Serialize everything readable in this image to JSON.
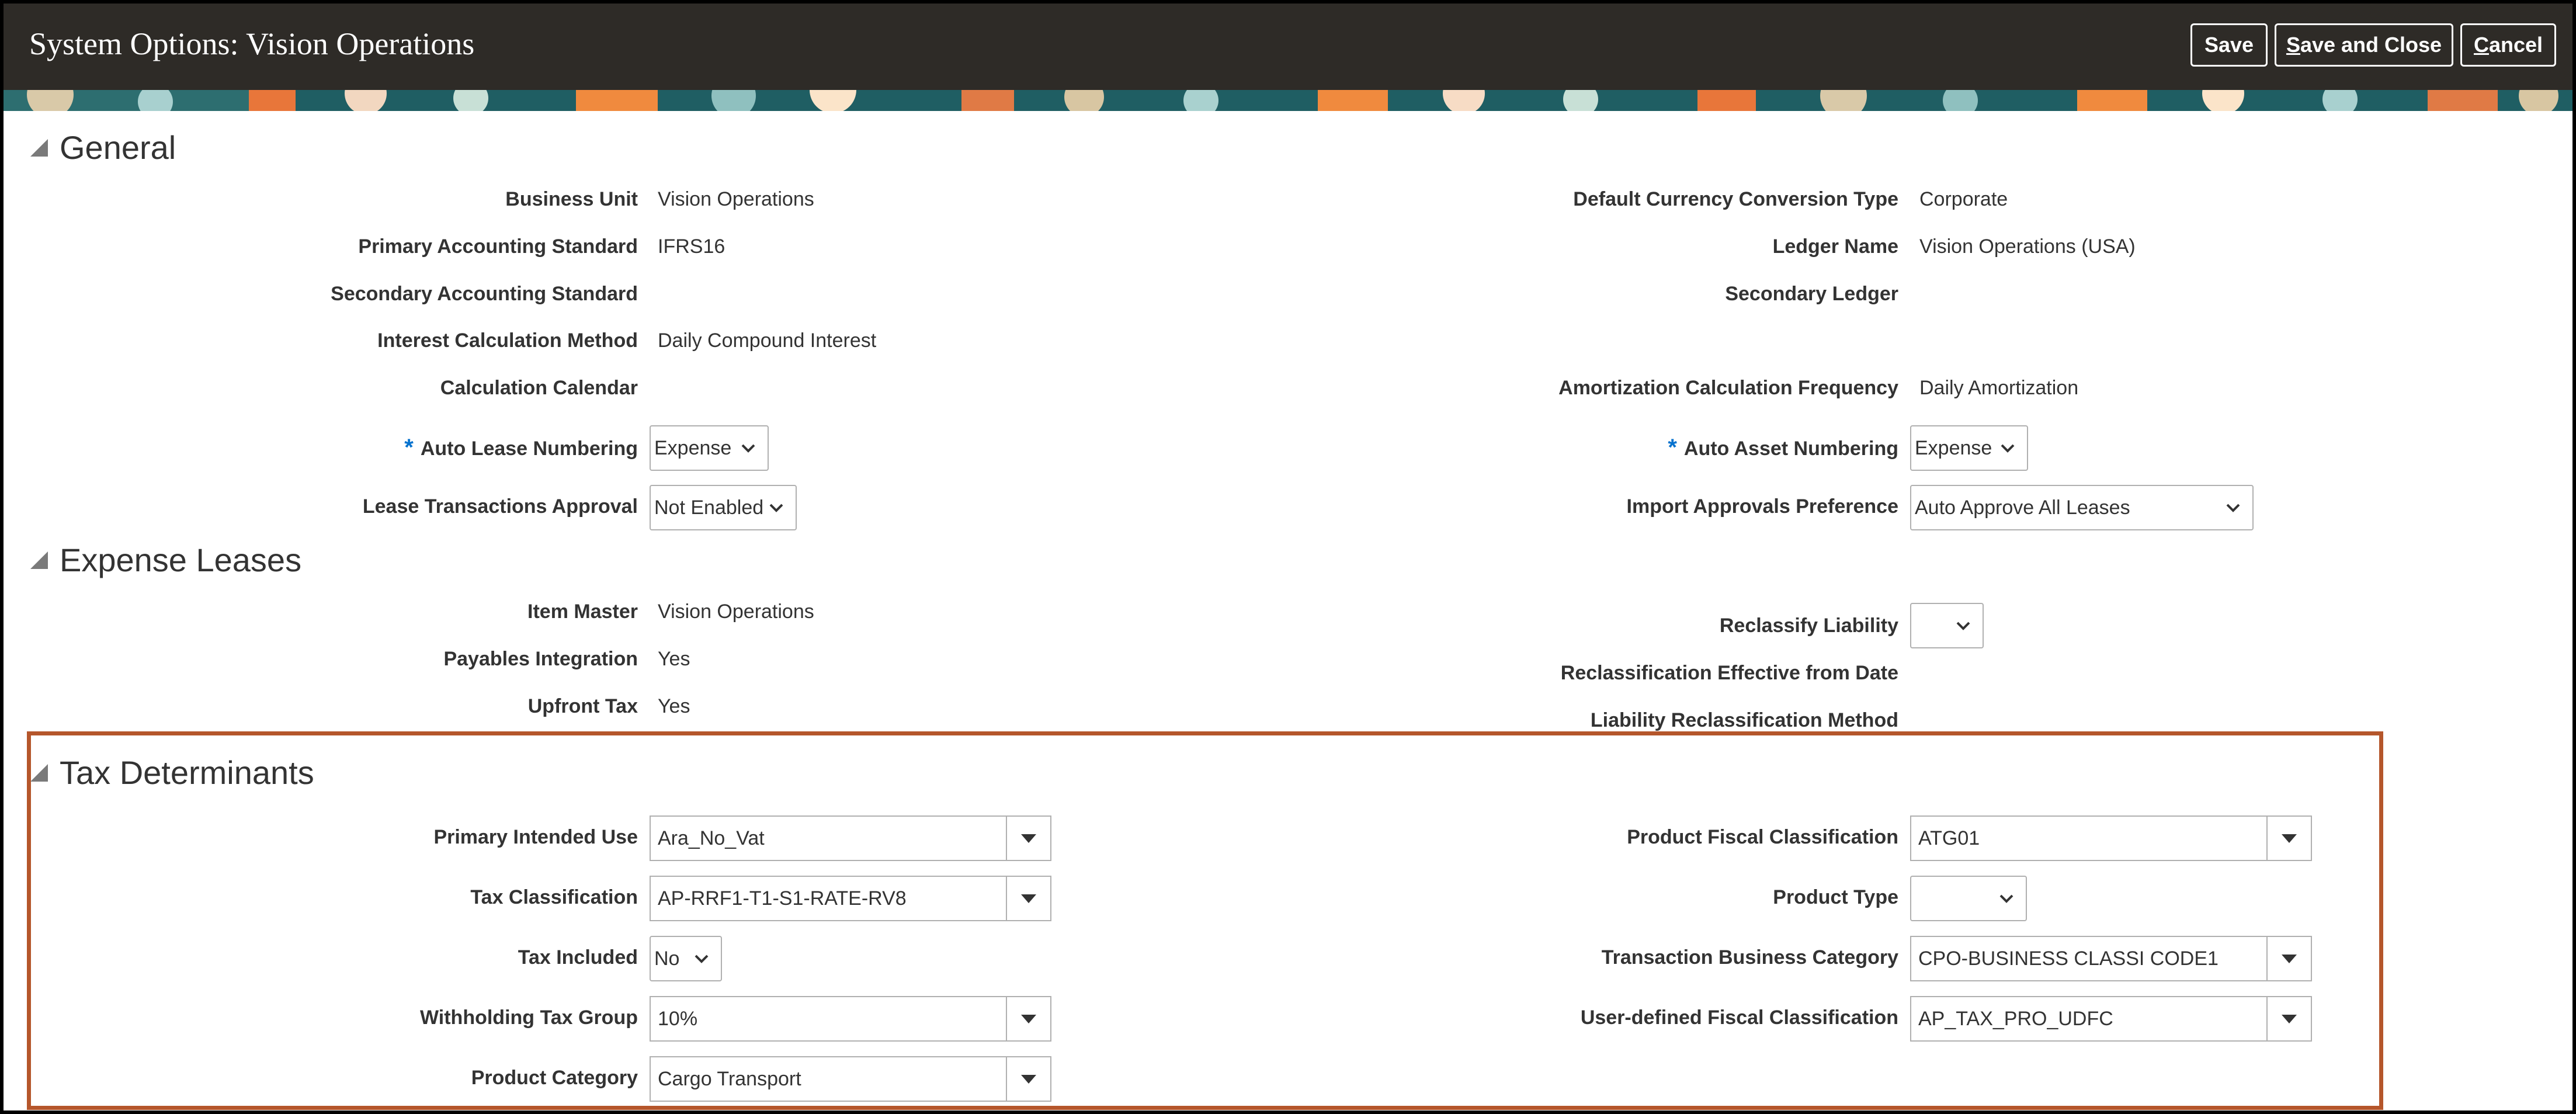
{
  "window": {
    "title": "System Options: Vision Operations"
  },
  "toolbar": {
    "save_label": "Save",
    "save_close_first": "S",
    "save_close_rest": "ave and Close",
    "cancel_first": "C",
    "cancel_rest": "ancel"
  },
  "colors": {
    "header_bg": "#2e2b27",
    "required_star": "#0572ce",
    "highlight_border": "#b5562b"
  },
  "general": {
    "heading": "General",
    "business_unit_label": "Business Unit",
    "business_unit_value": "Vision Operations",
    "primary_std_label": "Primary Accounting Standard",
    "primary_std_value": "IFRS16",
    "secondary_std_label": "Secondary Accounting Standard",
    "interest_method_label": "Interest Calculation Method",
    "interest_method_value": "Daily Compound Interest",
    "calc_calendar_label": "Calculation Calendar",
    "auto_lease_label": "Auto Lease Numbering",
    "auto_lease_value": "Expense",
    "lease_approval_label": "Lease Transactions Approval",
    "lease_approval_value": "Not Enabled",
    "default_conv_label": "Default Currency Conversion Type",
    "default_conv_value": "Corporate",
    "ledger_name_label": "Ledger Name",
    "ledger_name_value": "Vision Operations (USA)",
    "secondary_ledger_label": "Secondary Ledger",
    "amort_freq_label": "Amortization Calculation Frequency",
    "amort_freq_value": "Daily Amortization",
    "auto_asset_label": "Auto Asset Numbering",
    "auto_asset_value": "Expense",
    "import_pref_label": "Import Approvals Preference",
    "import_pref_value": "Auto Approve All Leases",
    "required_mark": "*"
  },
  "expense": {
    "heading": "Expense Leases",
    "item_master_label": "Item Master",
    "item_master_value": "Vision Operations",
    "payables_label": "Payables Integration",
    "payables_value": "Yes",
    "upfront_tax_label": "Upfront Tax",
    "upfront_tax_value": "Yes",
    "reclassify_label": "Reclassify Liability",
    "reclassify_value": "",
    "reclass_date_label": "Reclassification Effective from Date",
    "reclass_method_label": "Liability Reclassification Method"
  },
  "tax": {
    "heading": "Tax Determinants",
    "intended_use_label": "Primary Intended Use",
    "intended_use_value": "Ara_No_Vat",
    "tax_class_label": "Tax Classification",
    "tax_class_value": "AP-RRF1-T1-S1-RATE-RV8",
    "tax_included_label": "Tax Included",
    "tax_included_value": "No",
    "withholding_label": "Withholding Tax Group",
    "withholding_value": "10%",
    "product_category_label": "Product Category",
    "product_category_value": "Cargo Transport",
    "fiscal_class_label": "Product Fiscal Classification",
    "fiscal_class_value": "ATG01",
    "product_type_label": "Product Type",
    "product_type_value": "",
    "business_category_label": "Transaction Business Category",
    "business_category_value": "CPO-BUSINESS CLASSI CODE1",
    "user_fiscal_label": "User-defined Fiscal Classification",
    "user_fiscal_value": "AP_TAX_PRO_UDFC"
  }
}
